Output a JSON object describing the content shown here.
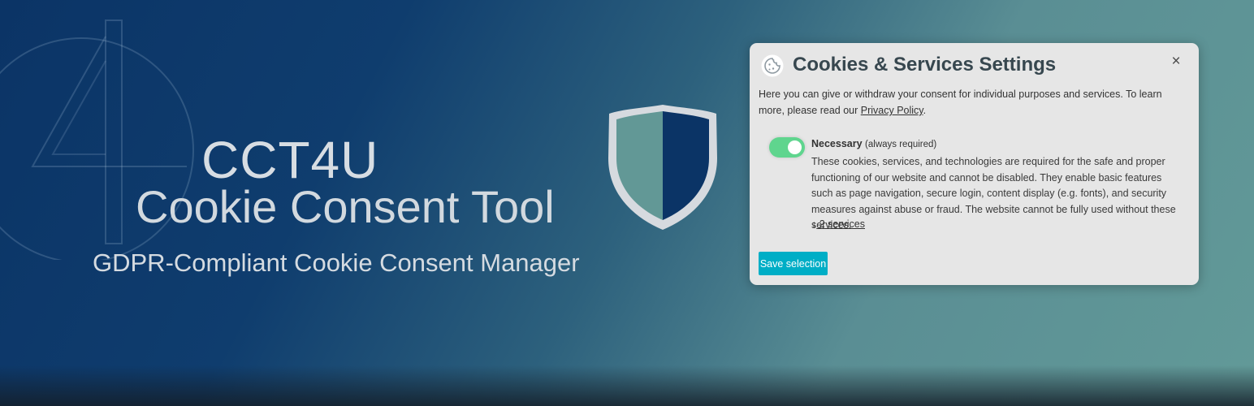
{
  "hero": {
    "title": "CCT4U",
    "subtitle": "Cookie Consent Tool",
    "tagline": "GDPR-Compliant Cookie Consent Manager"
  },
  "icons": {
    "logo": "cct4u-logo-mark",
    "shield": "shield-icon",
    "cookie": "cookie-icon",
    "close": "close-icon",
    "arrow": "arrow-down-icon"
  },
  "colors": {
    "background_start": "#0b3466",
    "background_end": "#629a98",
    "dialog_bg": "#e6e6e6",
    "title": "#37474f",
    "toggle_on": "#5fd58e",
    "button": "#00aec6",
    "shield_left": "#629896",
    "shield_right": "#0b3466",
    "shield_border": "#d6dadf"
  },
  "dialog": {
    "title": "Cookies & Services Settings",
    "close_label": "×",
    "intro": "Here you can give or withdraw your consent for individual purposes and services. To learn more, please read our ",
    "privacy_link": "Privacy Policy",
    "intro_end": ".",
    "purpose": {
      "name": "Necessary",
      "required_note": "(always required)",
      "enabled": true,
      "description": "These cookies, services, and technologies are required for the safe and proper functioning of our website and cannot be disabled. They enable basic features such as page navigation, secure login, content display (e.g. fonts), and security measures against abuse or fraud. The website cannot be fully used without these services.",
      "services_arrow": "↓",
      "services_label": " 2 services"
    },
    "save_label": "Save selection"
  }
}
